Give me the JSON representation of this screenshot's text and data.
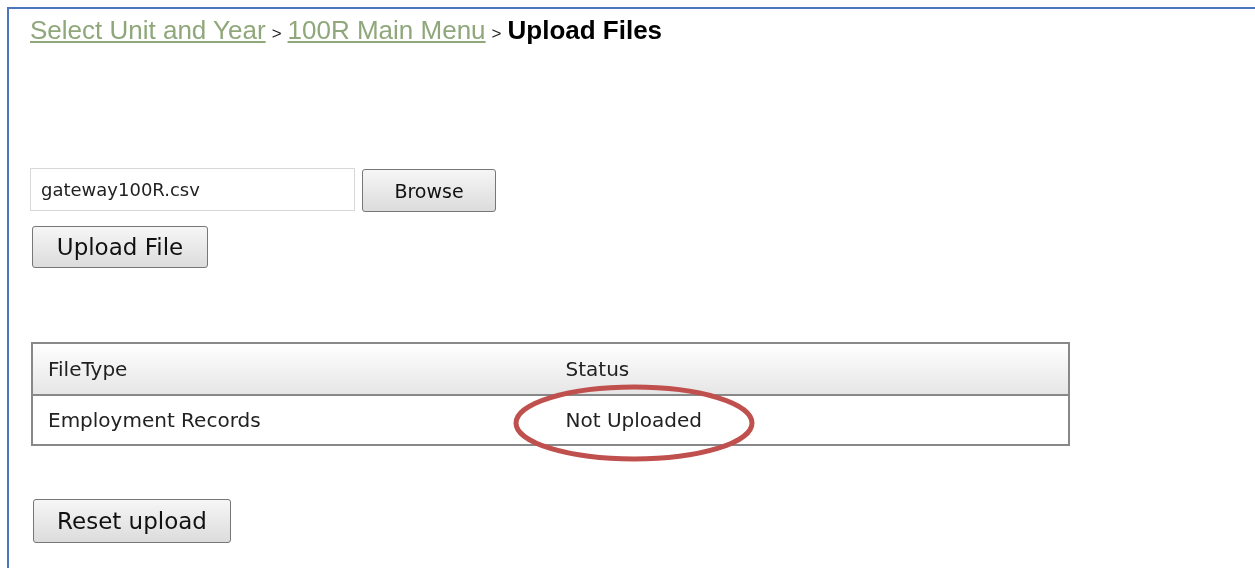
{
  "breadcrumb": [
    {
      "label": "Select Unit and Year",
      "kind": "link",
      "separator": ">"
    },
    {
      "label": "100R Main Menu",
      "kind": "link",
      "separator": ">"
    },
    {
      "label": "Upload Files",
      "kind": "current"
    }
  ],
  "file_field": {
    "value": "gateway100R.csv"
  },
  "browse_button": "Browse",
  "upload_button": "Upload File",
  "table": {
    "columns": [
      "FileType",
      "Status"
    ],
    "rows": [
      [
        "Employment Records",
        "Not Uploaded"
      ]
    ]
  },
  "reset_button": "Reset upload",
  "annotation": {
    "kind": "ellipse"
  }
}
